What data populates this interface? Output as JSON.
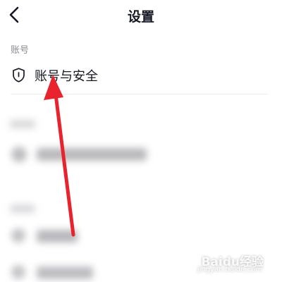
{
  "header": {
    "title": "设置",
    "back_icon": "chevron-left-icon"
  },
  "account_section": {
    "label": "账号",
    "items": [
      {
        "label": "账号与安全",
        "icon": "shield-icon"
      }
    ]
  },
  "annotation": {
    "type": "arrow",
    "color": "#e8232e"
  },
  "watermark": {
    "brand": "Baidu经验",
    "url": "jingyan.baidu.com"
  }
}
